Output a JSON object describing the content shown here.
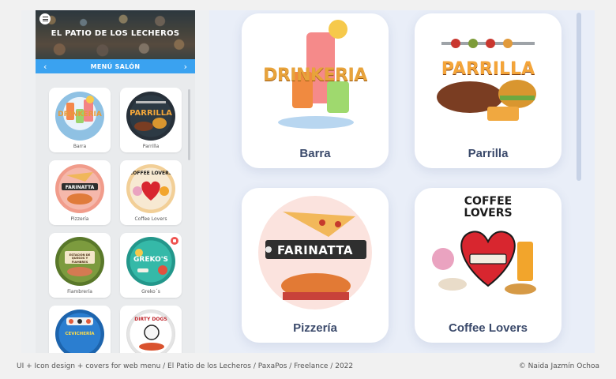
{
  "header": {
    "venue_title": "EL PATIO DE LOS LECHEROS",
    "menu_bar_label": "MENÚ SALÓN",
    "prev_arrow": "‹",
    "next_arrow": "›"
  },
  "phone_categories": [
    {
      "label": "Barra",
      "cover_text": "DRINKERIA"
    },
    {
      "label": "Parrilla",
      "cover_text": "PARRILLA"
    },
    {
      "label": "Pizzería",
      "cover_text": "FARINATTA"
    },
    {
      "label": "Coffee Lovers",
      "cover_text": "COFFEE LOVERS"
    },
    {
      "label": "Fiambrería",
      "cover_text": "ESTACIÓN DE QUESOS Y FIAMBRES"
    },
    {
      "label": "Greko´s",
      "cover_text": "GREKO'S"
    },
    {
      "label": "",
      "cover_text": "CEVICHERÍA"
    },
    {
      "label": "",
      "cover_text": "DIRTY DOGS"
    }
  ],
  "big_cards": [
    {
      "label": "Barra",
      "cover_text": "DRINKERIA"
    },
    {
      "label": "Parrilla",
      "cover_text": "PARRILLA"
    },
    {
      "label": "Pizzería",
      "cover_text": "FARINATTA"
    },
    {
      "label": "Coffee Lovers",
      "cover_text": "COFFEE LOVERS"
    }
  ],
  "footer": {
    "caption": "UI + Icon design + covers for web menu / El Patio de los Lecheros / PaxaPos / Freelance / 2022",
    "credit": "© Naida Jazmín Ochoa"
  },
  "colors": {
    "accent_bar": "#3aa2f0",
    "card_label": "#3b4a6b",
    "badge": "#ef5350"
  },
  "icons": {
    "menu": "hamburger-icon",
    "notification": "badge-icon"
  }
}
